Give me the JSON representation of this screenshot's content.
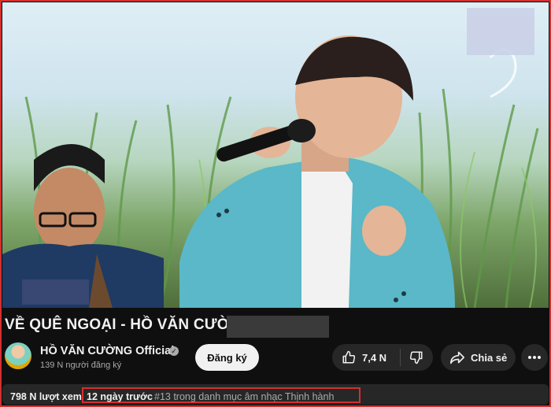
{
  "video": {
    "title": "VỀ QUÊ NGOẠI - HỒ VĂN CƯỜNG |"
  },
  "channel": {
    "name": "HỒ VĂN CƯỜNG Official",
    "verified_glyph": "✓",
    "subscribers": "139 N người đăng ký",
    "subscribe_label": "Đăng ký"
  },
  "actions": {
    "like_count": "7,4 N",
    "share_label": "Chia sẻ",
    "icons": [
      "thumb-up-icon",
      "thumb-down-icon",
      "share-arrow-icon",
      "more-icon"
    ]
  },
  "description": {
    "views": "798 N lượt xem",
    "date": "12 ngày trước",
    "trending": "#13 trong danh mục âm nhạc Thịnh hành"
  },
  "colors": {
    "background": "#0f0f0f",
    "button": "#272727",
    "highlight_border": "#d32f2f",
    "jacket": "#5ab8c8"
  }
}
